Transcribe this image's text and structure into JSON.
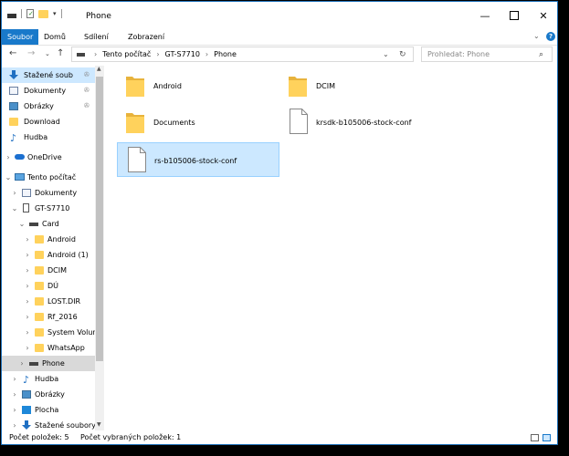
{
  "window": {
    "title": "Phone"
  },
  "ribbon": {
    "tabs": [
      "Soubor",
      "Domů",
      "Sdílení",
      "Zobrazení"
    ]
  },
  "address": {
    "crumbs": [
      "Tento počítač",
      "GT-S7710",
      "Phone"
    ],
    "search_placeholder": "Prohledat: Phone"
  },
  "nav": {
    "items": [
      {
        "label": "Stažené soub",
        "icon": "download-arrow-icon",
        "pinned": true
      },
      {
        "label": "Dokumenty",
        "icon": "documents-icon",
        "pinned": true
      },
      {
        "label": "Obrázky",
        "icon": "pictures-icon",
        "pinned": true
      },
      {
        "label": "Download",
        "icon": "folder-icon"
      },
      {
        "label": "Hudba",
        "icon": "music-icon"
      },
      {
        "label": "OneDrive",
        "icon": "cloud-icon"
      },
      {
        "label": "Tento počítač",
        "icon": "computer-icon"
      },
      {
        "label": "Dokumenty",
        "icon": "documents-icon"
      },
      {
        "label": "GT-S7710",
        "icon": "device-icon"
      },
      {
        "label": "Card",
        "icon": "drive-icon"
      },
      {
        "label": "Android",
        "icon": "folder-icon"
      },
      {
        "label": "Android (1)",
        "icon": "folder-icon"
      },
      {
        "label": "DCIM",
        "icon": "folder-icon"
      },
      {
        "label": "DÚ",
        "icon": "folder-icon"
      },
      {
        "label": "LOST.DIR",
        "icon": "folder-icon"
      },
      {
        "label": "Rf_2016",
        "icon": "folder-icon"
      },
      {
        "label": "System Volun",
        "icon": "folder-icon"
      },
      {
        "label": "WhatsApp",
        "icon": "folder-icon"
      },
      {
        "label": "Phone",
        "icon": "drive-icon"
      },
      {
        "label": "Hudba",
        "icon": "music-icon"
      },
      {
        "label": "Obrázky",
        "icon": "pictures-icon"
      },
      {
        "label": "Plocha",
        "icon": "desktop-icon"
      },
      {
        "label": "Stažené soubory",
        "icon": "download-arrow-icon"
      }
    ]
  },
  "content": {
    "items": [
      {
        "name": "Android",
        "type": "folder"
      },
      {
        "name": "DCIM",
        "type": "folder"
      },
      {
        "name": "Documents",
        "type": "folder"
      },
      {
        "name": "krsdk-b105006-stock-conf",
        "type": "file"
      },
      {
        "name": "rs-b105006-stock-conf",
        "type": "file",
        "selected": true
      }
    ]
  },
  "status": {
    "count": "Počet položek: 5",
    "selected": "Počet vybraných položek: 1"
  },
  "colors": {
    "accent": "#1979ca",
    "folder": "#ffd25c",
    "selection": "#cce8ff"
  }
}
